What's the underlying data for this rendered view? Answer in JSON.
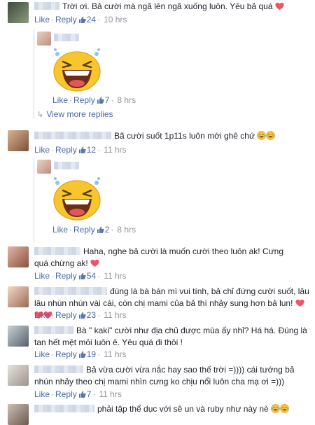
{
  "labels": {
    "like": "Like",
    "reply": "Reply",
    "sep": "·",
    "view_more": "View more replies"
  },
  "comments": [
    {
      "text": "Trời ơi. Bả cười mà ngã lên ngã xuống luôn. Yêu bả quá",
      "likes": "24",
      "time": "10 hrs"
    },
    {
      "likes": "7",
      "time": "8 hrs"
    },
    {
      "text": "Bã cười suốt 1p11s luôn mới ghê chứ",
      "likes": "12",
      "time": "11 hrs"
    },
    {
      "likes": "2",
      "time": "8 hrs"
    },
    {
      "text": "Haha, nghe bả cười là muốn cười theo luôn ak! Cưng quá chừng ak!",
      "likes": "54",
      "time": "11 hrs"
    },
    {
      "text": "đúng là bà bán mì vui tính, bả chỉ đứng cười suốt, lâu lâu nhún nhún vài cái, còn chị mami của bả thì nhảy sung hơn bả lun!",
      "likes": "23",
      "time": "11 hrs"
    },
    {
      "text": "Bà \" kaki\" cười như địa chủ được mùa ấy nhỉ? Há há. Đúng là tan hết mệt mỏi luôn ê. Yêu quá đi thôi !",
      "likes": "19",
      "time": "11 hrs"
    },
    {
      "text": "Bả vừa cười vừa nắc hay sao thế trời =)))) cái tướng bả nhún nhảy theo chị mami nhìn cưng ko chịu nổi luôn cha mạ ơi =)))",
      "likes": "7",
      "time": "11 hrs"
    },
    {
      "text": "phải tập thể dục với sê un và ruby như này nè"
    }
  ],
  "colors": {
    "link": "#4b68a8",
    "meta": "#90949c",
    "heart": "#f25268",
    "text": "#1d2129"
  }
}
